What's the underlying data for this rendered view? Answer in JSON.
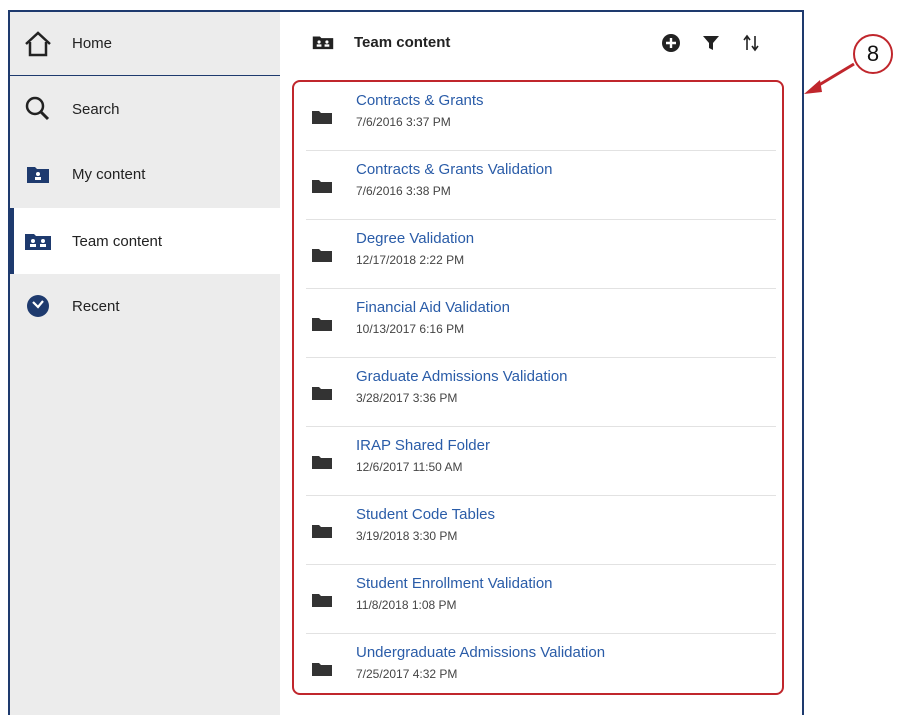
{
  "sidebar": {
    "items": [
      {
        "label": "Home",
        "icon": "home-icon"
      },
      {
        "label": "Search",
        "icon": "search-icon"
      },
      {
        "label": "My content",
        "icon": "my-content-icon"
      },
      {
        "label": "Team content",
        "icon": "team-content-icon"
      },
      {
        "label": "Recent",
        "icon": "recent-icon"
      }
    ],
    "active_item": "Team content"
  },
  "header": {
    "title": "Team content",
    "icon": "team-content-icon",
    "actions": [
      "add-icon",
      "filter-icon",
      "sort-icon"
    ]
  },
  "folders": [
    {
      "name": "Contracts & Grants",
      "date": "7/6/2016 3:37 PM"
    },
    {
      "name": "Contracts & Grants Validation",
      "date": "7/6/2016 3:38 PM"
    },
    {
      "name": "Degree Validation",
      "date": "12/17/2018 2:22 PM"
    },
    {
      "name": "Financial Aid Validation",
      "date": "10/13/2017 6:16 PM"
    },
    {
      "name": "Graduate Admissions Validation",
      "date": "3/28/2017 3:36 PM"
    },
    {
      "name": "IRAP Shared Folder",
      "date": "12/6/2017 11:50 AM"
    },
    {
      "name": "Student Code Tables",
      "date": "3/19/2018 3:30 PM"
    },
    {
      "name": "Student Enrollment Validation",
      "date": "11/8/2018 1:08 PM"
    },
    {
      "name": "Undergraduate Admissions Validation",
      "date": "7/25/2017 4:32 PM"
    }
  ],
  "annotation": {
    "number": "8",
    "color": "#c0262c"
  },
  "colors": {
    "accent": "#1e3a6e",
    "link": "#2a5ca8",
    "sidebar_bg": "#ececec"
  }
}
